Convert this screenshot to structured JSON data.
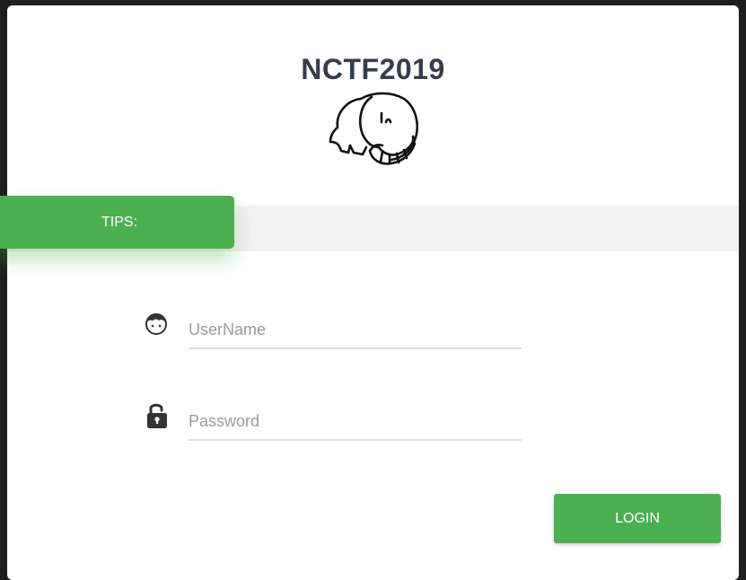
{
  "header": {
    "title": "NCTF2019",
    "logo_icon": "elephant-icon"
  },
  "tips": {
    "label": "TIPS:",
    "message": ""
  },
  "form": {
    "username": {
      "placeholder": "UserName",
      "value": "",
      "icon": "user-face-icon"
    },
    "password": {
      "placeholder": "Password",
      "value": "",
      "icon": "unlocked-padlock-icon"
    },
    "login_label": "LOGIN"
  },
  "colors": {
    "accent": "#4caf50",
    "title": "#343d4e",
    "tips_bar": "#f2f2f2",
    "background": "#1e1e1e"
  }
}
